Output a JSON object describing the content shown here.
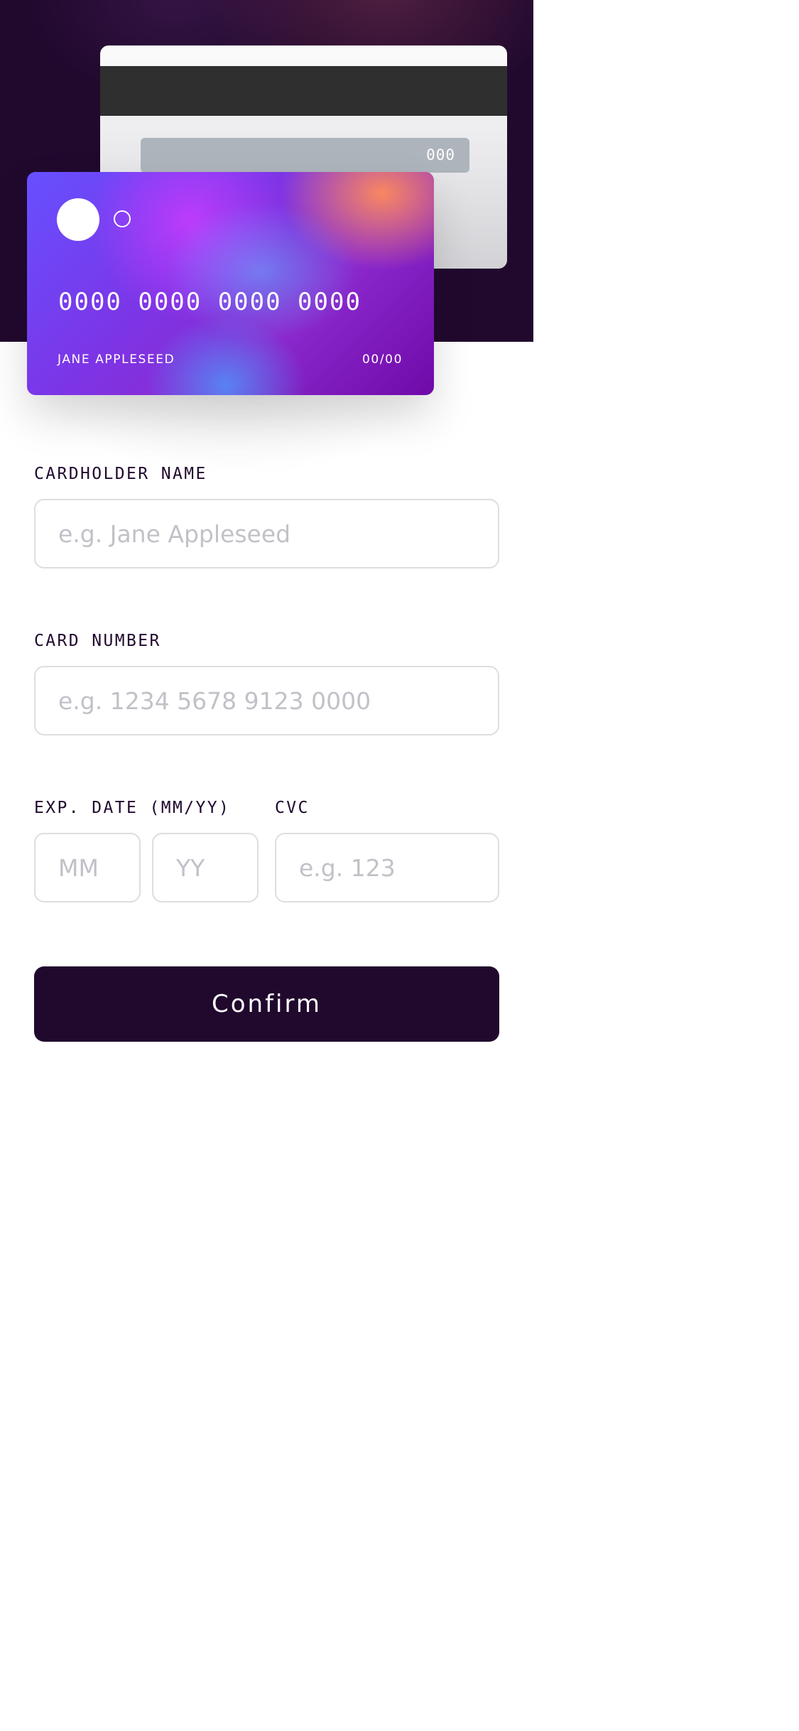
{
  "card_back": {
    "cvc": "000"
  },
  "card_front": {
    "number": "0000 0000 0000 0000",
    "holder": "JANE APPLESEED",
    "expiry": "00/00"
  },
  "form": {
    "name": {
      "label": "CARDHOLDER NAME",
      "placeholder": "e.g. Jane Appleseed"
    },
    "number": {
      "label": "CARD NUMBER",
      "placeholder": "e.g. 1234 5678 9123 0000"
    },
    "expiry": {
      "label": "EXP. DATE (MM/YY)",
      "month_placeholder": "MM",
      "year_placeholder": "YY"
    },
    "cvc": {
      "label": "CVC",
      "placeholder": "e.g. 123"
    },
    "confirm_label": "Confirm"
  },
  "colors": {
    "hero_background": "#21092e",
    "input_border": "#dedddf",
    "placeholder": "#c3c0c8",
    "button_background": "#21092e"
  }
}
